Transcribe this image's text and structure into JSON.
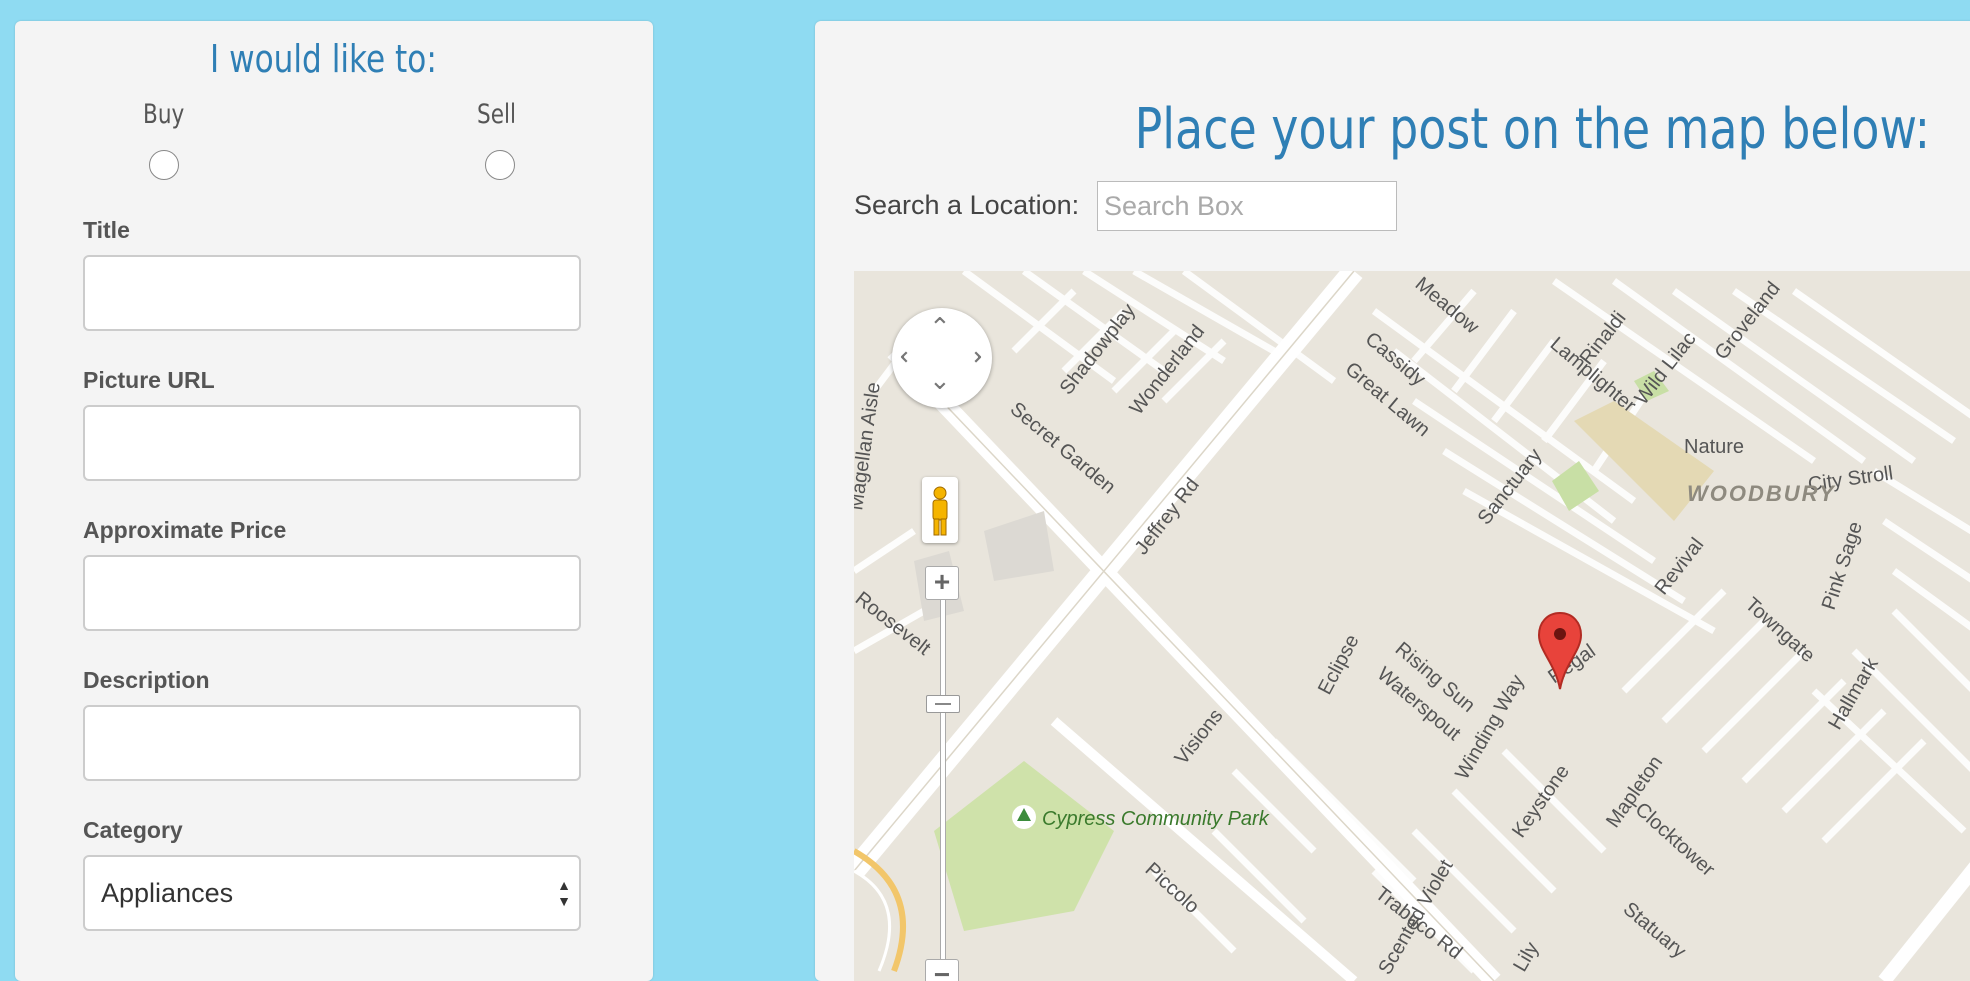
{
  "form": {
    "heading": "I would like to:",
    "intent_options": [
      {
        "label": "Buy",
        "checked": false
      },
      {
        "label": "Sell",
        "checked": false
      }
    ],
    "fields": [
      {
        "label": "Title",
        "value": ""
      },
      {
        "label": "Picture URL",
        "value": ""
      },
      {
        "label": "Approximate Price",
        "value": ""
      },
      {
        "label": "Description",
        "value": ""
      }
    ],
    "category": {
      "label": "Category",
      "selected": "Appliances"
    }
  },
  "map_section": {
    "heading": "Place your post on the map below:",
    "search_label": "Search a Location:",
    "search_placeholder": "Search Box",
    "search_value": ""
  },
  "map": {
    "streets": [
      "Jeffrey Rd",
      "Trabuco Rd",
      "Secret Garden",
      "Shadowplay",
      "Wonderland",
      "Magellan Aisle",
      "Roosevelt",
      "Visions",
      "Piccolo",
      "Cassidy",
      "Great Lawn",
      "Meadow",
      "Lamplighter",
      "Rinaldi",
      "Wild Lilac",
      "Groveland",
      "Sanctuary",
      "Nature",
      "City Stroll",
      "Revival",
      "Pink Sage",
      "Towngate",
      "Hallmark",
      "Eclipse",
      "Rising Sun",
      "Waterspout",
      "Winding Way",
      "Regal",
      "Keystone",
      "Mapleton",
      "Clocktower",
      "Statuary",
      "Lily",
      "Scented Violet"
    ],
    "neighborhood": "WOODBURY",
    "park": "Cypress Community Park",
    "controls": {
      "zoom_in": "+",
      "zoom_out": "−"
    }
  }
}
